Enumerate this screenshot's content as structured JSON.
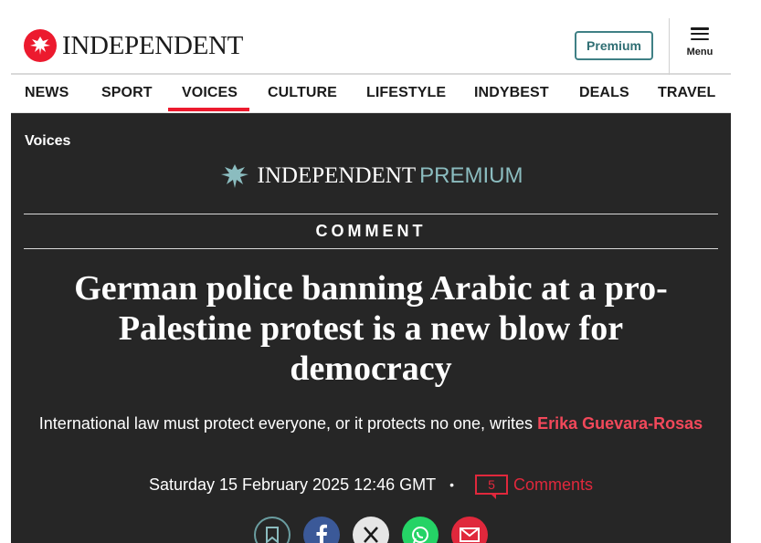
{
  "header": {
    "logo_text": "INDEPENDENT",
    "premium_button": "Premium",
    "menu_label": "Menu"
  },
  "nav": {
    "items": [
      "NEWS",
      "SPORT",
      "VOICES",
      "CULTURE",
      "LIFESTYLE",
      "INDYBEST",
      "DEALS",
      "TRAVEL"
    ],
    "active": "VOICES"
  },
  "article": {
    "section": "Voices",
    "brand_word": "INDEPENDENT",
    "brand_premium": "PREMIUM",
    "kicker": "COMMENT",
    "headline": "German police banning Arabic at a pro-Palestine protest is a new blow for democracy",
    "standfirst": "International law must protect everyone, or it protects no one, writes",
    "author": "Erika Guevara-Rosas",
    "date": "Saturday 15 February 2025 12:46 GMT",
    "comment_count": "5",
    "comments_label": "Comments"
  },
  "share_icons": [
    "bookmark-icon",
    "facebook-icon",
    "x-icon",
    "whatsapp-icon",
    "email-icon"
  ],
  "colors": {
    "brand_red": "#ec1a2e",
    "panel_bg": "#262626",
    "premium_teal": "#3f8085",
    "author_red": "#f2485a"
  }
}
